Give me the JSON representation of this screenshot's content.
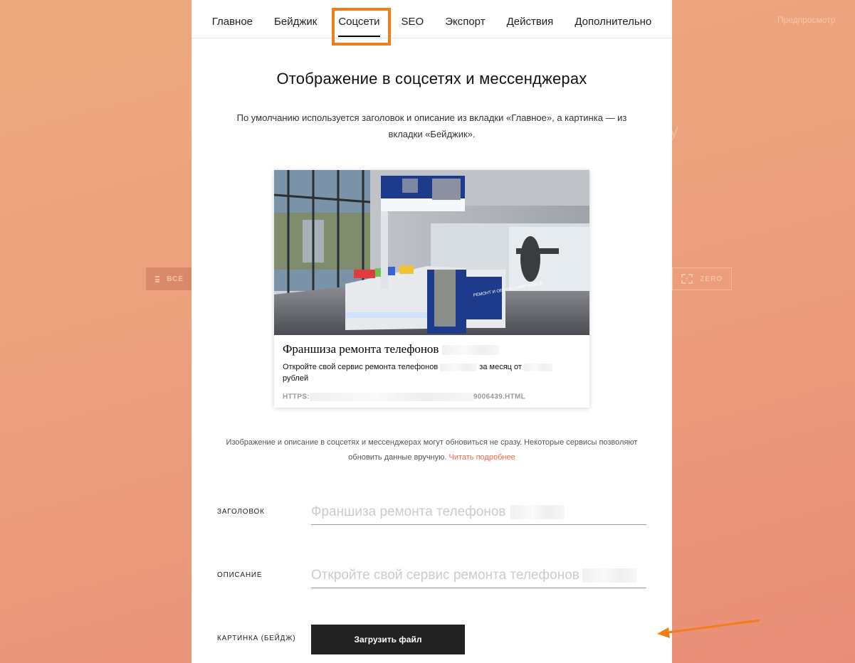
{
  "background": {
    "preview_label": "Предпросмотр",
    "stray_letter": "у",
    "btn_all_label": "ВСЕ",
    "btn_zero_label": "ZERO",
    "zero_icon_glyph": "⚡"
  },
  "tabs": [
    {
      "label": "Главное"
    },
    {
      "label": "Бейджик"
    },
    {
      "label": "Соцсети",
      "active": true
    },
    {
      "label": "SEO"
    },
    {
      "label": "Экспорт"
    },
    {
      "label": "Действия"
    },
    {
      "label": "Дополнительно"
    }
  ],
  "section": {
    "title": "Отображение в соцсетях и мессенджерах",
    "description": "По умолчанию используется заголовок и описание из вкладки «Главное», а картинка — из вкладки «Бейджик»."
  },
  "preview_card": {
    "image_sign_text": "РЕМОНТ И ОБМЕН СМАРТФОНОВ",
    "title": "Франшиза ремонта телефонов",
    "description_start": "Откройте свой сервис ремонта телефонов",
    "description_mid": " за месяц от",
    "description_end": "рублей",
    "url_start": "HTTPS:",
    "url_end": "9006439.HTML"
  },
  "note": {
    "text": "Изображение и описание в соцсетях и мессенджерах могут обновиться не сразу. Некоторые сервисы позволяют обновить данные вручную.",
    "link_label": "Читать подробнее"
  },
  "fields": {
    "title_label": "ЗАГОЛОВОК",
    "title_value": "Франшиза ремонта телефонов",
    "description_label": "ОПИСАНИЕ",
    "description_value": "Откройте свой сервис ремонта телефонов",
    "image_label": "КАРТИНКА (БЕЙДЖ)",
    "upload_label": "Загрузить файл"
  },
  "colors": {
    "accent_orange": "#f07f1a",
    "link": "#f4674b",
    "button_dark": "#222222"
  }
}
